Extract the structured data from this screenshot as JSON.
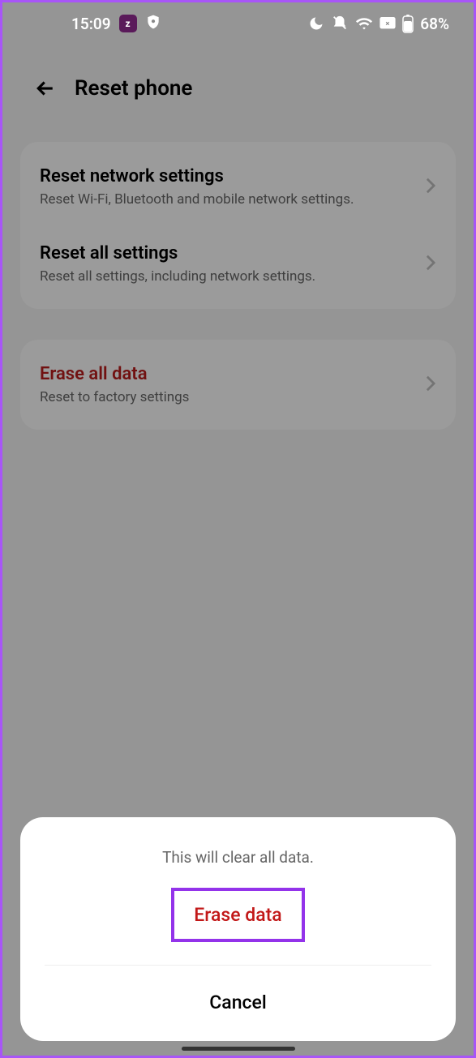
{
  "status": {
    "time": "15:09",
    "battery": "68%"
  },
  "header": {
    "title": "Reset phone"
  },
  "sections": {
    "network": {
      "title": "Reset network settings",
      "subtitle": "Reset Wi-Fi, Bluetooth and mobile network settings."
    },
    "all": {
      "title": "Reset all settings",
      "subtitle": "Reset all settings, including network settings."
    },
    "erase": {
      "title": "Erase all data",
      "subtitle": "Reset to factory settings"
    }
  },
  "sheet": {
    "message": "This will clear all data.",
    "confirm": "Erase data",
    "cancel": "Cancel"
  }
}
